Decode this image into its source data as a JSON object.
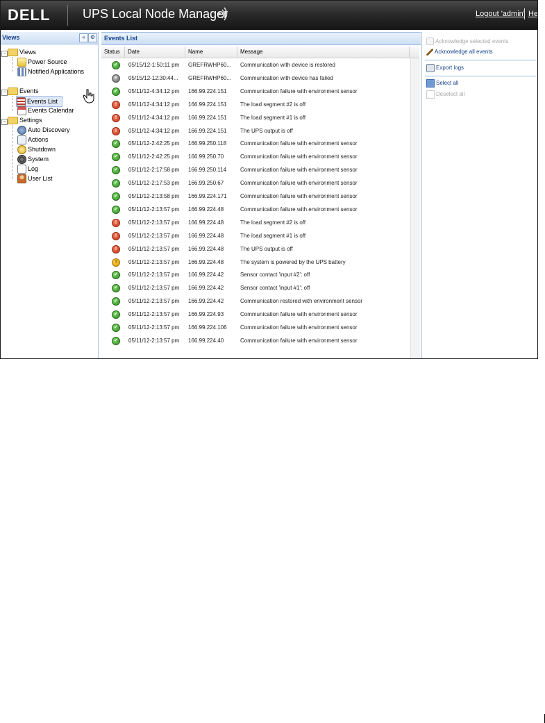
{
  "header": {
    "logo": "DELL",
    "title": "UPS Local Node Manager",
    "logout": "Logout 'admin'",
    "help": "He"
  },
  "views_panel": {
    "title": "Views",
    "tree": [
      {
        "label": "Views",
        "type": "folder"
      },
      {
        "label": "Power Source",
        "type": "item",
        "icon": "power-source-icon"
      },
      {
        "label": "Notified Applications",
        "type": "item",
        "icon": "applications-icon"
      },
      {
        "label": "Events",
        "type": "folder"
      },
      {
        "label": "Events List",
        "type": "item",
        "icon": "events-list-icon",
        "selected": true
      },
      {
        "label": "Events Calendar",
        "type": "item",
        "icon": "calendar-icon"
      },
      {
        "label": "Settings",
        "type": "folder"
      },
      {
        "label": "Auto Discovery",
        "type": "item",
        "icon": "discovery-icon"
      },
      {
        "label": "Actions",
        "type": "item",
        "icon": "actions-icon"
      },
      {
        "label": "Shutdown",
        "type": "item",
        "icon": "shutdown-icon"
      },
      {
        "label": "System",
        "type": "item",
        "icon": "gear-icon"
      },
      {
        "label": "Log",
        "type": "item",
        "icon": "log-icon"
      },
      {
        "label": "User List",
        "type": "item",
        "icon": "users-icon"
      }
    ]
  },
  "events": {
    "title": "Events List",
    "columns": [
      "Status",
      "Date",
      "Name",
      "Message"
    ],
    "rows": [
      {
        "status": "ok",
        "date": "05/15/12-1:50:11 pm",
        "name": "GREFRWHP60...",
        "message": "Communication with device is restored"
      },
      {
        "status": "fail",
        "date": "05/15/12-12:30:44...",
        "name": "GREFRWHP60...",
        "message": "Communication with device has failed"
      },
      {
        "status": "ok",
        "date": "05/11/12-4:34:12 pm",
        "name": "166.99.224.151",
        "message": "Communication failure with environment sensor"
      },
      {
        "status": "err",
        "date": "05/11/12-4:34:12 pm",
        "name": "166.99.224.151",
        "message": "The load segment #2 is off"
      },
      {
        "status": "err",
        "date": "05/11/12-4:34:12 pm",
        "name": "166.99.224.151",
        "message": "The load segment #1 is off"
      },
      {
        "status": "err",
        "date": "05/11/12-4:34:12 pm",
        "name": "166.99.224.151",
        "message": "The UPS output is off"
      },
      {
        "status": "ok",
        "date": "05/11/12-2:42:25 pm",
        "name": "166.99.250.118",
        "message": "Communication failure with environment sensor"
      },
      {
        "status": "ok",
        "date": "05/11/12-2:42:25 pm",
        "name": "166.99.250.70",
        "message": "Communication failure with environment sensor"
      },
      {
        "status": "ok",
        "date": "05/11/12-2:17:58 pm",
        "name": "166.99.250.114",
        "message": "Communication failure with environment sensor"
      },
      {
        "status": "ok",
        "date": "05/11/12-2:17:53 pm",
        "name": "166.99.250.67",
        "message": "Communication failure with environment sensor"
      },
      {
        "status": "ok",
        "date": "05/11/12-2:13:58 pm",
        "name": "166.99.224.171",
        "message": "Communication failure with environment sensor"
      },
      {
        "status": "ok",
        "date": "05/11/12-2:13:57 pm",
        "name": "166.99.224.48",
        "message": "Communication failure with environment sensor"
      },
      {
        "status": "err",
        "date": "05/11/12-2:13:57 pm",
        "name": "166.99.224.48",
        "message": "The load segment #2 is off"
      },
      {
        "status": "err",
        "date": "05/11/12-2:13:57 pm",
        "name": "166.99.224.48",
        "message": "The load segment #1 is off"
      },
      {
        "status": "err",
        "date": "05/11/12-2:13:57 pm",
        "name": "166.99.224.48",
        "message": "The UPS output is off"
      },
      {
        "status": "warn",
        "date": "05/11/12-2:13:57 pm",
        "name": "166.99.224.48",
        "message": "The system is powered by the UPS battery"
      },
      {
        "status": "ok",
        "date": "05/11/12-2:13:57 pm",
        "name": "166.99.224.42",
        "message": "Sensor contact 'input #2': off"
      },
      {
        "status": "ok",
        "date": "05/11/12-2:13:57 pm",
        "name": "166.99.224.42",
        "message": "Sensor contact 'input #1': off"
      },
      {
        "status": "ok",
        "date": "05/11/12-2:13:57 pm",
        "name": "166.99.224.42",
        "message": "Communication restored with environment sensor"
      },
      {
        "status": "ok",
        "date": "05/11/12-2:13:57 pm",
        "name": "166.99.224.93",
        "message": "Communication failure with environment sensor"
      },
      {
        "status": "ok",
        "date": "05/11/12-2:13:57 pm",
        "name": "166.99.224.106",
        "message": "Communication failure with environment sensor"
      },
      {
        "status": "ok",
        "date": "05/11/12-2:13:57 pm",
        "name": "166.99.224.40",
        "message": "Communication failure with environment sensor"
      }
    ]
  },
  "actions_panel": {
    "acknowledge_selected": "Acknowledge selected events",
    "acknowledge_all": "Acknowledge all events",
    "export_logs": "Export logs",
    "select_all": "Select all",
    "deselect_all": "Deselect all"
  },
  "colors": {
    "header_bg": "#1e1e1e",
    "panel_title": "#15428b",
    "status_ok": "#2e8a1f",
    "status_error": "#c2361a",
    "status_warning": "#d99a00",
    "status_failed": "#6b6b6b"
  }
}
